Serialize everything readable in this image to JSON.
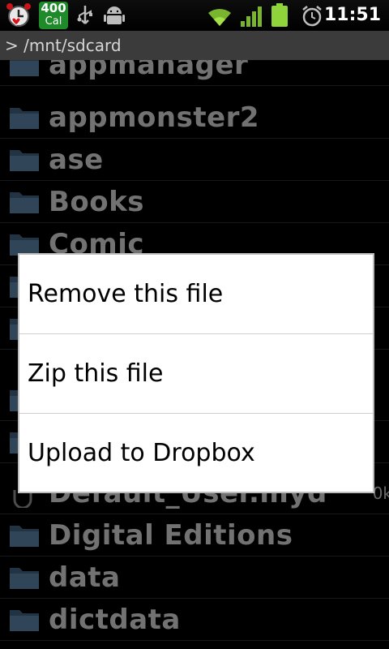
{
  "status_bar": {
    "icons": [
      "alarm-heart-app-icon",
      "usb-icon",
      "android-debug-icon",
      "wifi-icon",
      "signal-icon",
      "battery-icon",
      "alarm-clock-icon"
    ],
    "calorie_badge": {
      "value": "400",
      "unit": "Cal"
    },
    "time": "11:51",
    "accent_green": "#1f8a2a",
    "battery_color": "#8fd43b"
  },
  "path_bar": {
    "path": "> /mnt/sdcard"
  },
  "file_list": {
    "items": [
      {
        "name": "appmanager",
        "type": "folder",
        "size": ""
      },
      {
        "name": "appmonster2",
        "type": "folder",
        "size": ""
      },
      {
        "name": "ase",
        "type": "folder",
        "size": ""
      },
      {
        "name": "Books",
        "type": "folder",
        "size": ""
      },
      {
        "name": "Comic",
        "type": "folder",
        "size": ""
      },
      {
        "name": "",
        "type": "folder",
        "size": ""
      },
      {
        "name": "",
        "type": "folder",
        "size": ""
      },
      {
        "name": "",
        "type": "folder",
        "size": ""
      },
      {
        "name": "",
        "type": "folder",
        "size": ""
      },
      {
        "name": "Default_User.myd",
        "type": "file",
        "size": "0k"
      },
      {
        "name": "Digital Editions",
        "type": "folder",
        "size": ""
      },
      {
        "name": "data",
        "type": "folder",
        "size": ""
      },
      {
        "name": "dictdata",
        "type": "folder",
        "size": ""
      }
    ]
  },
  "context_menu": {
    "items": [
      {
        "label": "Remove this file"
      },
      {
        "label": "Zip this file"
      },
      {
        "label": "Upload to Dropbox"
      }
    ]
  }
}
